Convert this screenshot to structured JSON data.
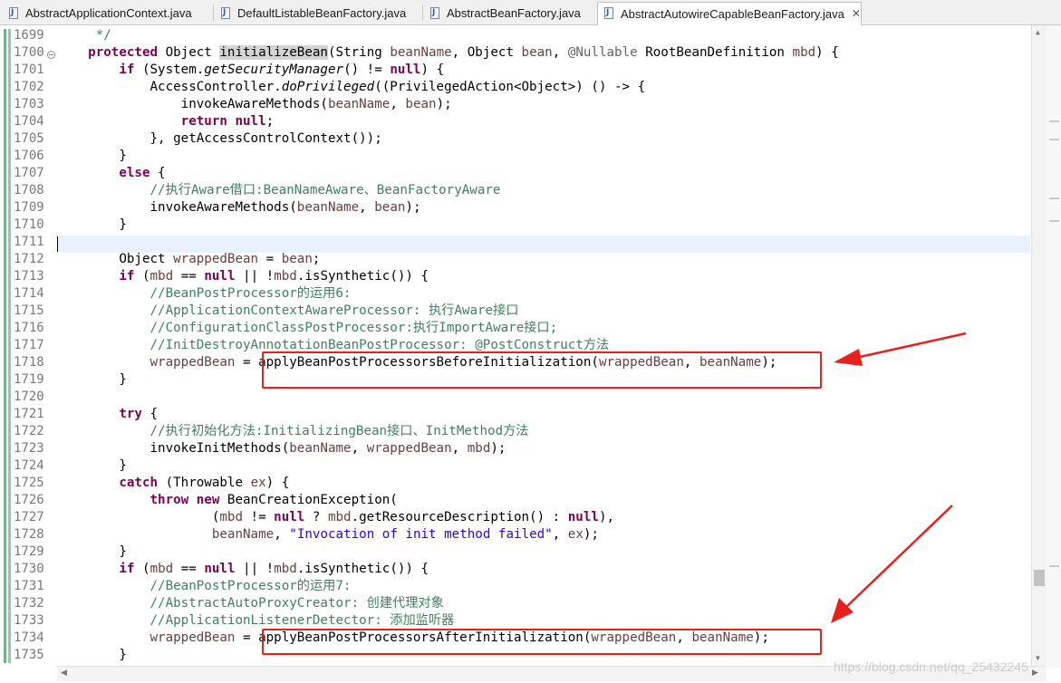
{
  "tabs": [
    {
      "label": "AbstractApplicationContext.java",
      "icon": "java-file-icon"
    },
    {
      "label": "DefaultListableBeanFactory.java",
      "icon": "java-file-icon"
    },
    {
      "label": "AbstractBeanFactory.java",
      "icon": "java-file-icon"
    },
    {
      "label": "AbstractAutowireCapableBeanFactory.java",
      "icon": "java-file-icon",
      "active": true,
      "close": "✕"
    }
  ],
  "editor": {
    "lines": [
      {
        "n": "1699",
        "parts": [
          [
            "",
            "     "
          ],
          [
            "cm",
            "*/"
          ]
        ]
      },
      {
        "n": "1700",
        "parts": [
          [
            "",
            "    "
          ],
          [
            "kw",
            "protected"
          ],
          [
            "",
            " Object "
          ],
          [
            "hl",
            "initializeBean"
          ],
          [
            "",
            "(String "
          ],
          [
            "var",
            "beanName"
          ],
          [
            "",
            ", Object "
          ],
          [
            "var",
            "bean"
          ],
          [
            "",
            ", "
          ],
          [
            "ann",
            "@Nullable"
          ],
          [
            "",
            " RootBeanDefinition "
          ],
          [
            "var",
            "mbd"
          ],
          [
            "",
            ") {"
          ]
        ]
      },
      {
        "n": "1701",
        "parts": [
          [
            "",
            "        "
          ],
          [
            "kw",
            "if"
          ],
          [
            "",
            " (System."
          ],
          [
            "it",
            "getSecurityManager"
          ],
          [
            "",
            "() != "
          ],
          [
            "kw",
            "null"
          ],
          [
            "",
            ") {"
          ]
        ]
      },
      {
        "n": "1702",
        "parts": [
          [
            "",
            "            AccessController."
          ],
          [
            "it",
            "doPrivileged"
          ],
          [
            "",
            "((PrivilegedAction<Object>) () -> {"
          ]
        ]
      },
      {
        "n": "1703",
        "parts": [
          [
            "",
            "                invokeAwareMethods("
          ],
          [
            "var",
            "beanName"
          ],
          [
            "",
            ", "
          ],
          [
            "var",
            "bean"
          ],
          [
            "",
            ");"
          ]
        ]
      },
      {
        "n": "1704",
        "parts": [
          [
            "",
            "                "
          ],
          [
            "kw",
            "return"
          ],
          [
            "",
            " "
          ],
          [
            "kw",
            "null"
          ],
          [
            "",
            ";"
          ]
        ]
      },
      {
        "n": "1705",
        "parts": [
          [
            "",
            "            }, getAccessControlContext());"
          ]
        ]
      },
      {
        "n": "1706",
        "parts": [
          [
            "",
            "        }"
          ]
        ]
      },
      {
        "n": "1707",
        "parts": [
          [
            "",
            "        "
          ],
          [
            "kw",
            "else"
          ],
          [
            "",
            " {"
          ]
        ]
      },
      {
        "n": "1708",
        "parts": [
          [
            "",
            "            "
          ],
          [
            "cm",
            "//执行Aware借口:BeanNameAware、BeanFactoryAware"
          ]
        ]
      },
      {
        "n": "1709",
        "parts": [
          [
            "",
            "            invokeAwareMethods("
          ],
          [
            "var",
            "beanName"
          ],
          [
            "",
            ", "
          ],
          [
            "var",
            "bean"
          ],
          [
            "",
            ");"
          ]
        ]
      },
      {
        "n": "1710",
        "parts": [
          [
            "",
            "        }"
          ]
        ]
      },
      {
        "n": "1711",
        "parts": []
      },
      {
        "n": "1712",
        "parts": [
          [
            "",
            "        Object "
          ],
          [
            "var",
            "wrappedBean"
          ],
          [
            "",
            " = "
          ],
          [
            "var",
            "bean"
          ],
          [
            "",
            ";"
          ]
        ]
      },
      {
        "n": "1713",
        "parts": [
          [
            "",
            "        "
          ],
          [
            "kw",
            "if"
          ],
          [
            "",
            " ("
          ],
          [
            "var",
            "mbd"
          ],
          [
            "",
            " == "
          ],
          [
            "kw",
            "null"
          ],
          [
            "",
            " || !"
          ],
          [
            "var",
            "mbd"
          ],
          [
            "",
            ".isSynthetic()) {"
          ]
        ]
      },
      {
        "n": "1714",
        "parts": [
          [
            "",
            "            "
          ],
          [
            "cm",
            "//BeanPostProcessor的运用6:"
          ]
        ]
      },
      {
        "n": "1715",
        "parts": [
          [
            "",
            "            "
          ],
          [
            "cm",
            "//ApplicationContextAwareProcessor: 执行Aware接口"
          ]
        ]
      },
      {
        "n": "1716",
        "parts": [
          [
            "",
            "            "
          ],
          [
            "cm",
            "//ConfigurationClassPostProcessor:执行ImportAware接口;"
          ]
        ]
      },
      {
        "n": "1717",
        "parts": [
          [
            "",
            "            "
          ],
          [
            "cm",
            "//InitDestroyAnnotationBeanPostProcessor: @PostConstruct方法"
          ]
        ]
      },
      {
        "n": "1718",
        "parts": [
          [
            "",
            "            "
          ],
          [
            "var",
            "wrappedBean"
          ],
          [
            "",
            " = applyBeanPostProcessorsBeforeInitialization("
          ],
          [
            "var",
            "wrappedBean"
          ],
          [
            "",
            ", "
          ],
          [
            "var",
            "beanName"
          ],
          [
            "",
            ");"
          ]
        ]
      },
      {
        "n": "1719",
        "parts": [
          [
            "",
            "        }"
          ]
        ]
      },
      {
        "n": "1720",
        "parts": []
      },
      {
        "n": "1721",
        "parts": [
          [
            "",
            "        "
          ],
          [
            "kw",
            "try"
          ],
          [
            "",
            " {"
          ]
        ]
      },
      {
        "n": "1722",
        "parts": [
          [
            "",
            "            "
          ],
          [
            "cm",
            "//执行初始化方法:InitializingBean接口、InitMethod方法"
          ]
        ]
      },
      {
        "n": "1723",
        "parts": [
          [
            "",
            "            invokeInitMethods("
          ],
          [
            "var",
            "beanName"
          ],
          [
            "",
            ", "
          ],
          [
            "var",
            "wrappedBean"
          ],
          [
            "",
            ", "
          ],
          [
            "var",
            "mbd"
          ],
          [
            "",
            ");"
          ]
        ]
      },
      {
        "n": "1724",
        "parts": [
          [
            "",
            "        }"
          ]
        ]
      },
      {
        "n": "1725",
        "parts": [
          [
            "",
            "        "
          ],
          [
            "kw",
            "catch"
          ],
          [
            "",
            " (Throwable "
          ],
          [
            "var",
            "ex"
          ],
          [
            "",
            ") {"
          ]
        ]
      },
      {
        "n": "1726",
        "parts": [
          [
            "",
            "            "
          ],
          [
            "kw",
            "throw"
          ],
          [
            "",
            " "
          ],
          [
            "kw",
            "new"
          ],
          [
            "",
            " BeanCreationException("
          ]
        ]
      },
      {
        "n": "1727",
        "parts": [
          [
            "",
            "                    ("
          ],
          [
            "var",
            "mbd"
          ],
          [
            "",
            " != "
          ],
          [
            "kw",
            "null"
          ],
          [
            "",
            " ? "
          ],
          [
            "var",
            "mbd"
          ],
          [
            "",
            ".getResourceDescription() : "
          ],
          [
            "kw",
            "null"
          ],
          [
            "",
            "),"
          ]
        ]
      },
      {
        "n": "1728",
        "parts": [
          [
            "",
            "                    "
          ],
          [
            "var",
            "beanName"
          ],
          [
            "",
            ", "
          ],
          [
            "str",
            "\"Invocation of init method failed\""
          ],
          [
            "",
            ", "
          ],
          [
            "var",
            "ex"
          ],
          [
            "",
            ");"
          ]
        ]
      },
      {
        "n": "1729",
        "parts": [
          [
            "",
            "        }"
          ]
        ]
      },
      {
        "n": "1730",
        "parts": [
          [
            "",
            "        "
          ],
          [
            "kw",
            "if"
          ],
          [
            "",
            " ("
          ],
          [
            "var",
            "mbd"
          ],
          [
            "",
            " == "
          ],
          [
            "kw",
            "null"
          ],
          [
            "",
            " || !"
          ],
          [
            "var",
            "mbd"
          ],
          [
            "",
            ".isSynthetic()) {"
          ]
        ]
      },
      {
        "n": "1731",
        "parts": [
          [
            "",
            "            "
          ],
          [
            "cm",
            "//BeanPostProcessor的运用7:"
          ]
        ]
      },
      {
        "n": "1732",
        "parts": [
          [
            "",
            "            "
          ],
          [
            "cm",
            "//AbstractAutoProxyCreator: 创建代理对象"
          ]
        ]
      },
      {
        "n": "1733",
        "parts": [
          [
            "",
            "            "
          ],
          [
            "cm",
            "//ApplicationListenerDetector: 添加监听器"
          ]
        ]
      },
      {
        "n": "1734",
        "parts": [
          [
            "",
            "            "
          ],
          [
            "var",
            "wrappedBean"
          ],
          [
            "",
            " = applyBeanPostProcessorsAfterInitialization("
          ],
          [
            "var",
            "wrappedBean"
          ],
          [
            "",
            ", "
          ],
          [
            "var",
            "beanName"
          ],
          [
            "",
            ");"
          ]
        ]
      },
      {
        "n": "1735",
        "parts": [
          [
            "",
            "        }"
          ]
        ]
      }
    ]
  },
  "watermark": "https://blog.csdn.net/qq_25432245",
  "colors": {
    "keyword": "#7f0055",
    "comment": "#3f7f5f",
    "variable": "#6a3e3e",
    "string": "#2a00ff",
    "annotation_box": "#e8201c"
  }
}
